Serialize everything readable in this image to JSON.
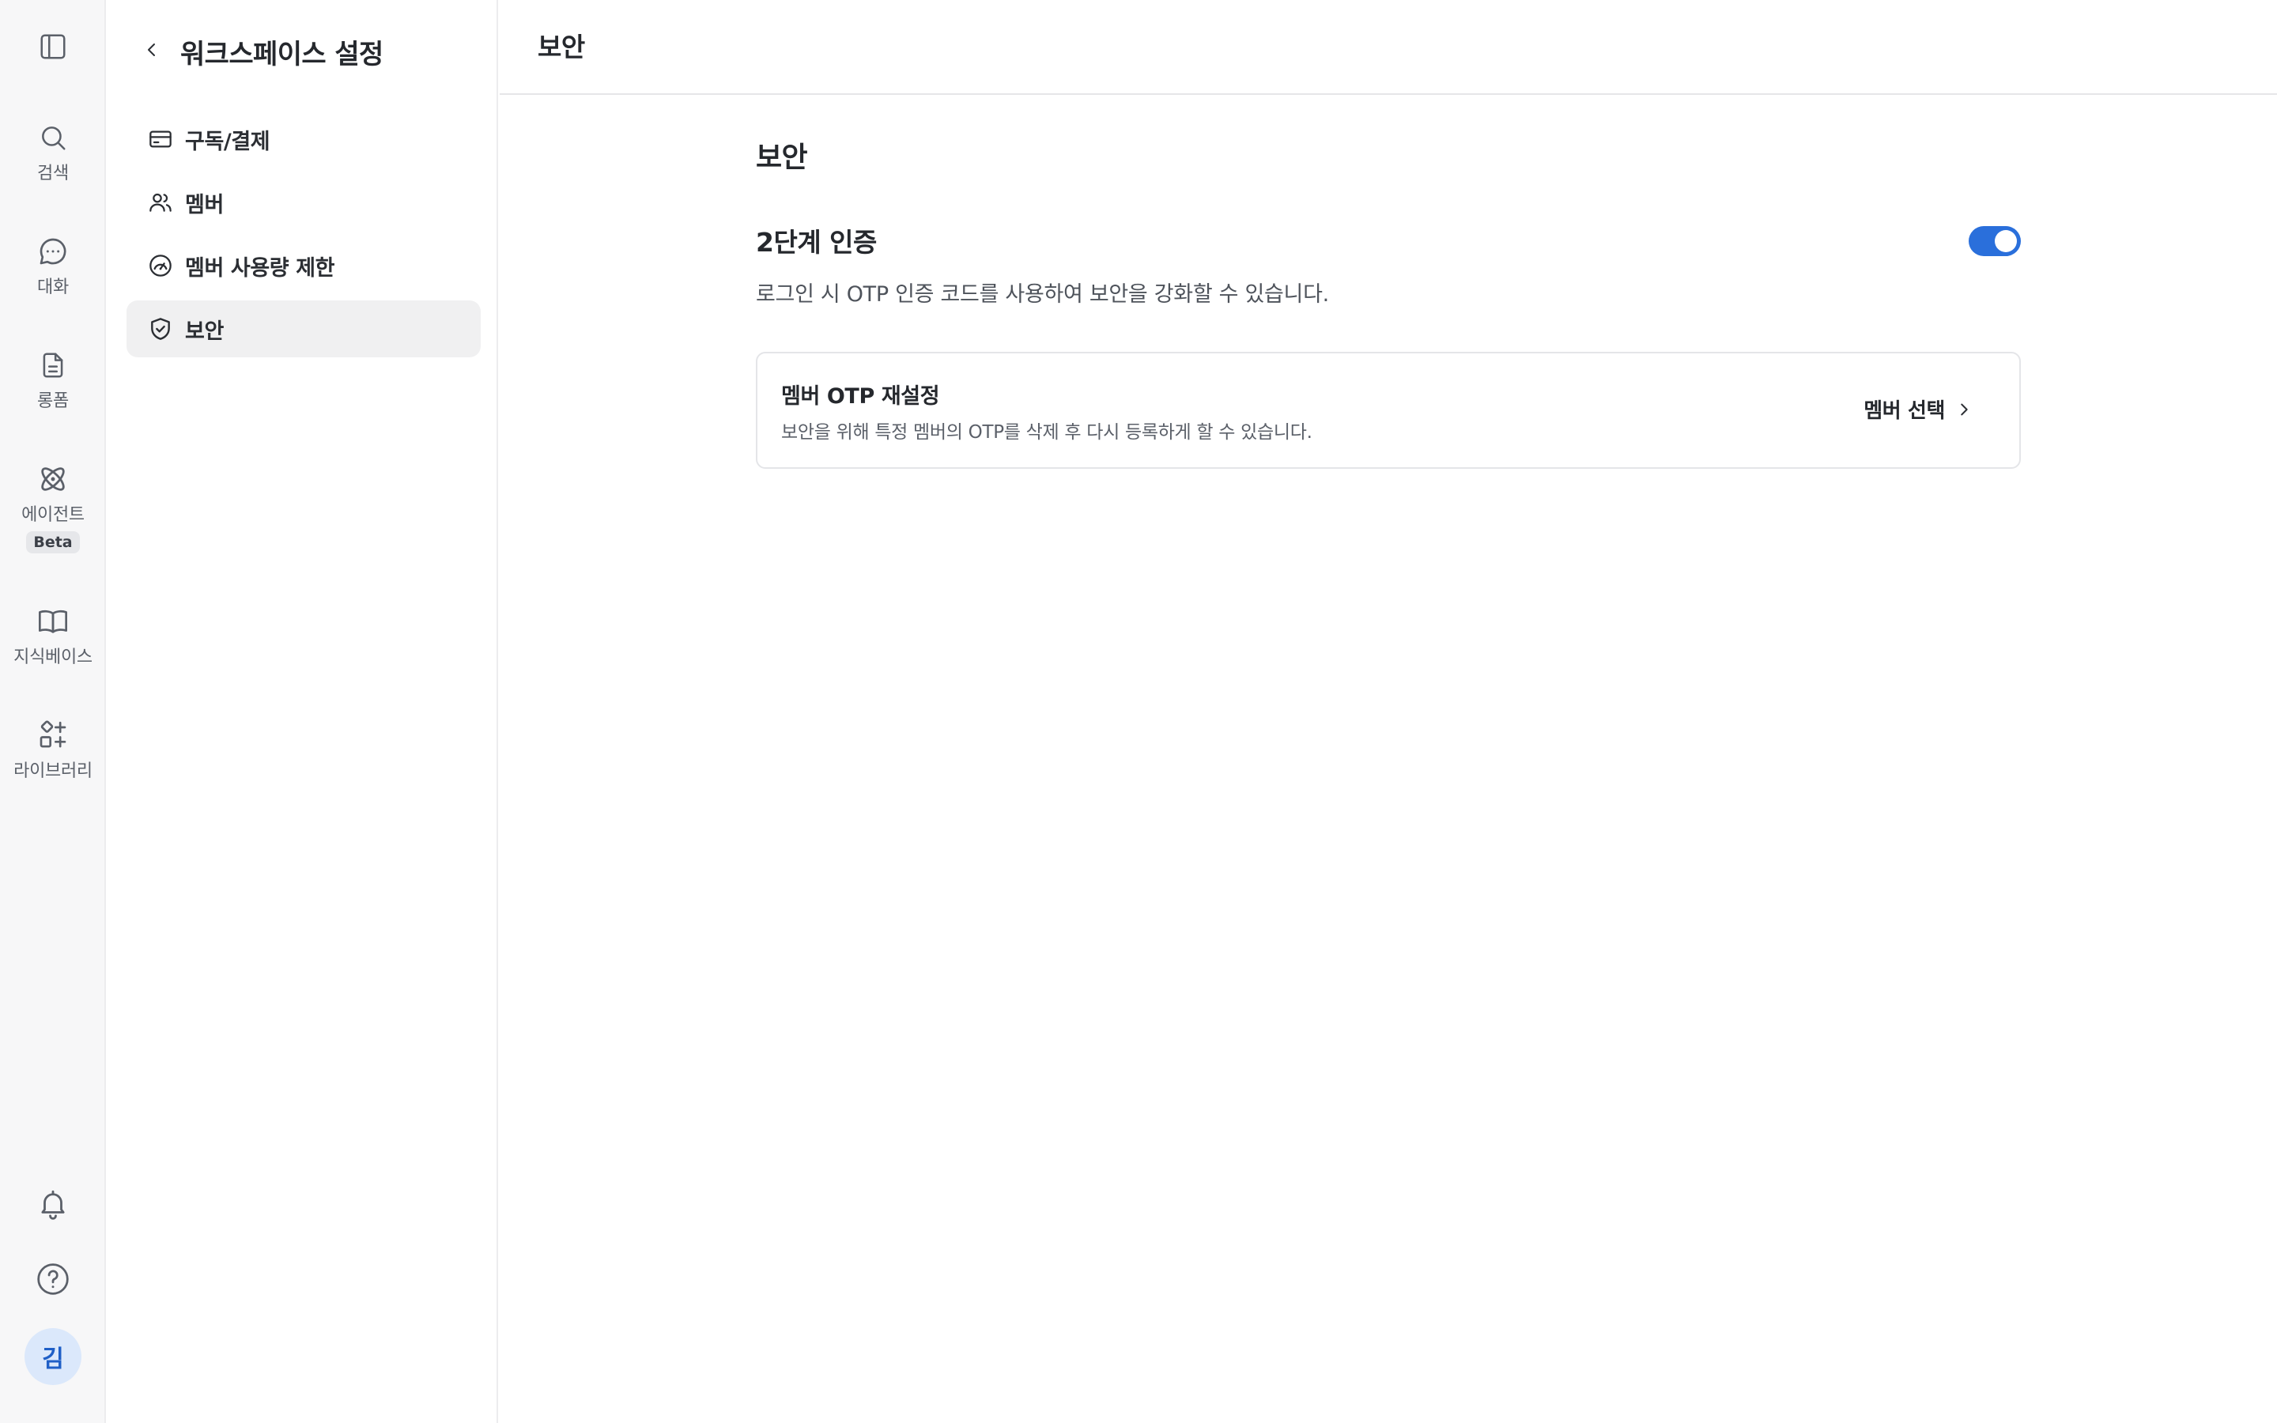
{
  "rail": {
    "items": [
      {
        "label": "검색",
        "icon": "search-icon"
      },
      {
        "label": "대화",
        "icon": "chat-icon"
      },
      {
        "label": "롱폼",
        "icon": "document-icon"
      },
      {
        "label": "에이전트",
        "icon": "agent-icon",
        "badge": "Beta"
      },
      {
        "label": "지식베이스",
        "icon": "book-icon"
      },
      {
        "label": "라이브러리",
        "icon": "library-icon"
      }
    ],
    "avatar_initial": "김"
  },
  "sidebar": {
    "title": "워크스페이스 설정",
    "items": [
      {
        "label": "구독/결제",
        "icon": "credit-card-icon"
      },
      {
        "label": "멤버",
        "icon": "users-icon"
      },
      {
        "label": "멤버 사용량 제한",
        "icon": "gauge-icon"
      },
      {
        "label": "보안",
        "icon": "shield-check-icon",
        "active": true
      }
    ]
  },
  "header": {
    "title": "보안"
  },
  "main": {
    "page_title": "보안",
    "two_factor": {
      "title": "2단계 인증",
      "description": "로그인 시 OTP 인증 코드를 사용하여 보안을 강화할 수 있습니다.",
      "enabled": true
    },
    "otp_reset": {
      "title": "멤버 OTP 재설정",
      "description": "보안을 위해 특정 멤버의 OTP를 삭제 후 다시 등록하게 할 수 있습니다.",
      "action_label": "멤버 선택"
    }
  },
  "colors": {
    "accent": "#2a6fdb",
    "avatar_bg": "#dbe8fb",
    "active_nav_bg": "#f0f0f1"
  }
}
